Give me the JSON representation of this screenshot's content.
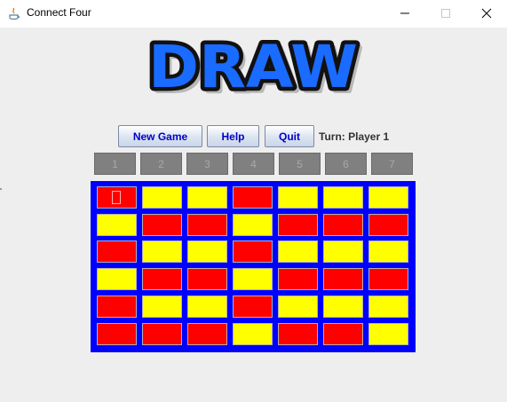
{
  "window": {
    "title": "Connect Four"
  },
  "banner": {
    "text": "DRAW"
  },
  "controls": {
    "new_game_label": "New Game",
    "help_label": "Help",
    "quit_label": "Quit",
    "turn_text": "Turn: Player 1"
  },
  "columns": [
    "1",
    "2",
    "3",
    "4",
    "5",
    "6",
    "7"
  ],
  "board": {
    "rows": [
      [
        "red",
        "yellow",
        "yellow",
        "red",
        "yellow",
        "yellow",
        "yellow"
      ],
      [
        "yellow",
        "red",
        "red",
        "yellow",
        "red",
        "red",
        "red"
      ],
      [
        "red",
        "yellow",
        "yellow",
        "red",
        "yellow",
        "yellow",
        "yellow"
      ],
      [
        "yellow",
        "red",
        "red",
        "yellow",
        "red",
        "red",
        "red"
      ],
      [
        "red",
        "yellow",
        "yellow",
        "red",
        "yellow",
        "yellow",
        "yellow"
      ],
      [
        "red",
        "red",
        "red",
        "yellow",
        "red",
        "red",
        "yellow"
      ]
    ]
  },
  "colors": {
    "board_blue": "#0000ff",
    "red_piece": "#ff0000",
    "yellow_piece": "#ffff00",
    "banner_fill": "#1a6bff",
    "button_text": "#0000cc"
  }
}
